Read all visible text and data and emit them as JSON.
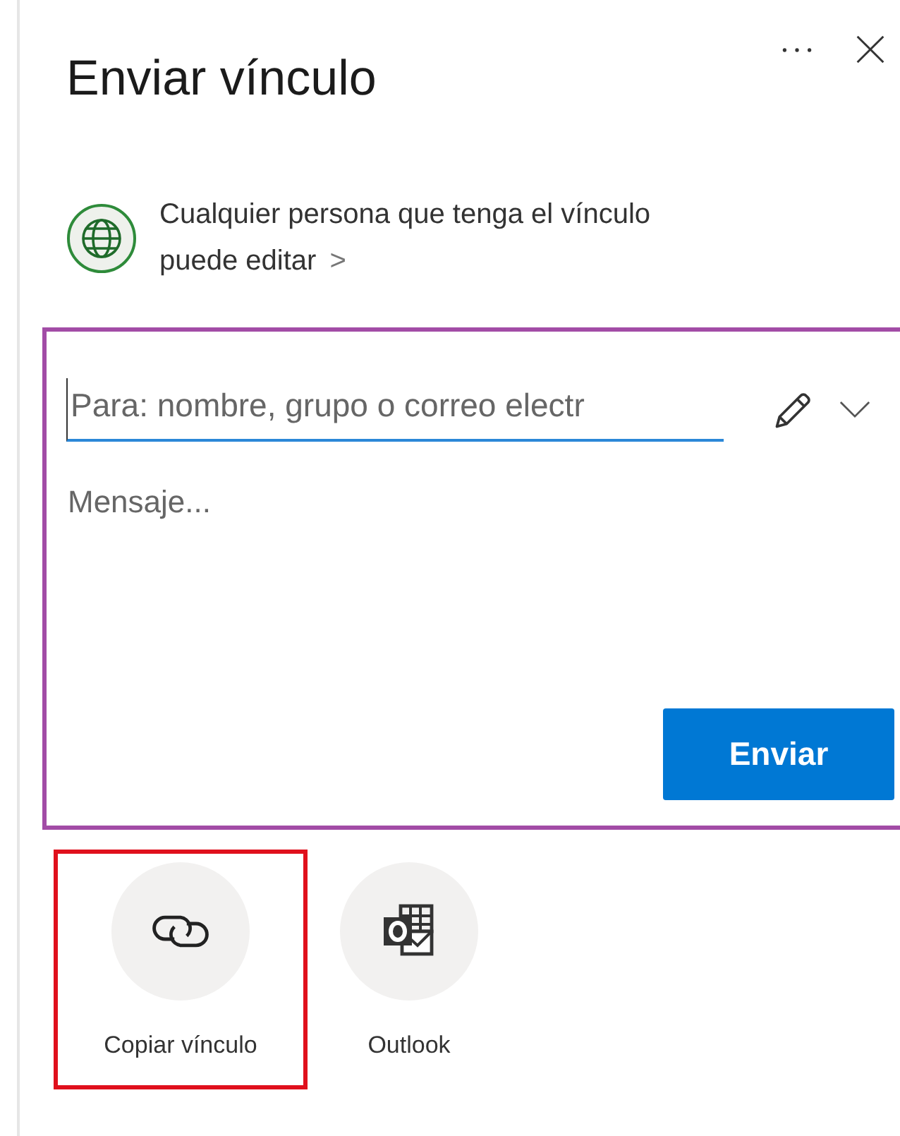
{
  "panel": {
    "title": "Enviar vínculo"
  },
  "permission": {
    "line_1": "Cualquier persona que tenga el vínculo",
    "line_2": "puede editar",
    "chevron": ">"
  },
  "compose": {
    "highlighted": true,
    "to_placeholder": "Para: nombre, grupo o correo electr",
    "message_placeholder": "Mensaje...",
    "send_label": "Enviar"
  },
  "share_options": [
    {
      "kind": "copy-link",
      "label": "Copiar vínculo",
      "highlighted": true
    },
    {
      "kind": "outlook",
      "label": "Outlook",
      "highlighted": false
    }
  ]
}
